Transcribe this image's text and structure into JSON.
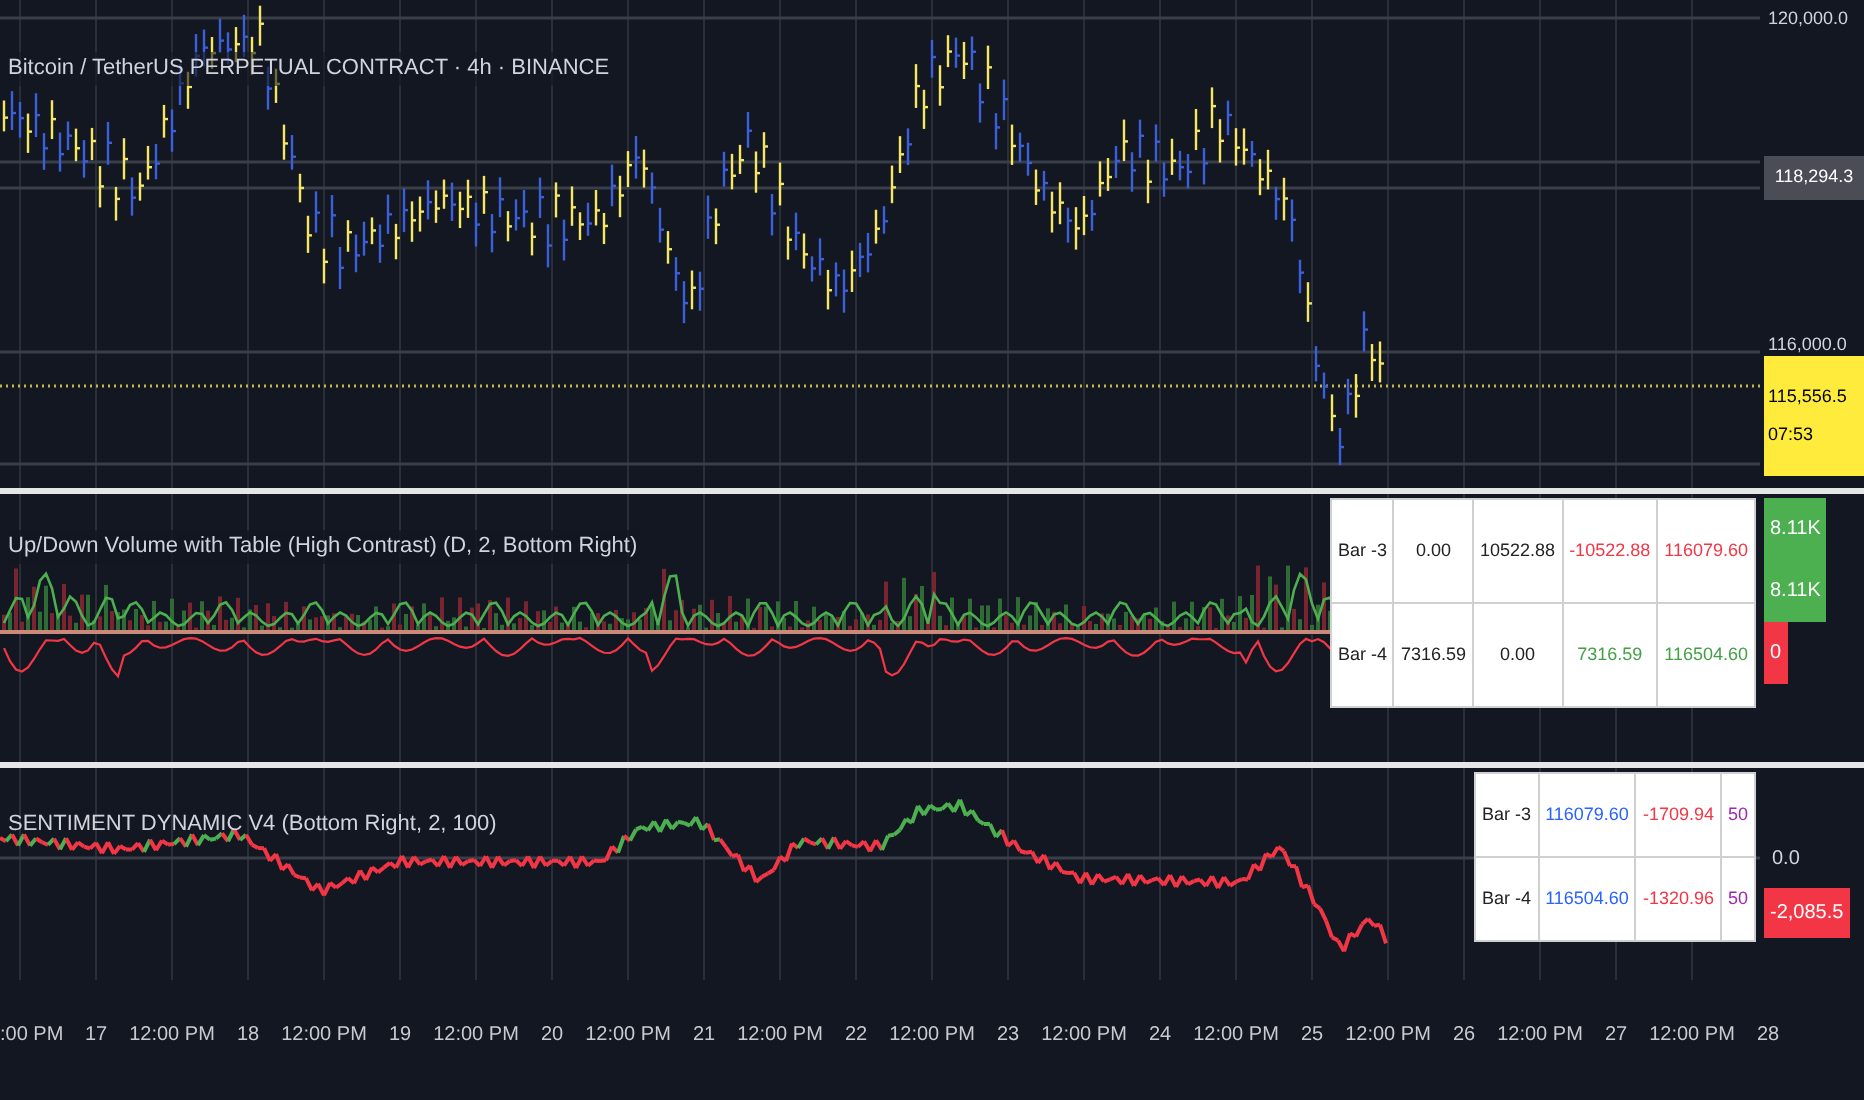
{
  "symbol_legend": "Bitcoin / TetherUS PERPETUAL CONTRACT · 4h · BINANCE",
  "price_axis": {
    "marks": [
      {
        "text": "120,000.0",
        "kind": "label"
      },
      {
        "text": "118,294.3",
        "kind": "tag"
      },
      {
        "text": "116,000.0",
        "kind": "label"
      }
    ],
    "last_price": {
      "price": "115,556.5",
      "countdown": "07:53"
    }
  },
  "volume_pane": {
    "legend": "Up/Down Volume with Table (High Contrast) (D, 2, Bottom Right)",
    "table": {
      "rows": [
        {
          "cells": [
            {
              "text": "Bar -3"
            },
            {
              "text": "0.00"
            },
            {
              "text": "10522.88"
            },
            {
              "text": "-10522.88",
              "color": "#f23645"
            },
            {
              "text": "116079.60",
              "color": "#f23645"
            }
          ]
        },
        {
          "cells": [
            {
              "text": "Bar -4"
            },
            {
              "text": "7316.59"
            },
            {
              "text": "0.00"
            },
            {
              "text": "7316.59",
              "color": "#43a047"
            },
            {
              "text": "116504.60",
              "color": "#43a047"
            }
          ]
        }
      ]
    },
    "axis_tags": [
      {
        "text": "8.11K",
        "color": "#4caf50"
      },
      {
        "text": "8.11K",
        "color": "#4caf50"
      },
      {
        "text": "0",
        "color": "#f23645"
      }
    ]
  },
  "sentiment_pane": {
    "legend": "SENTIMENT DYNAMIC V4 (Bottom Right, 2, 100)",
    "table": {
      "rows": [
        {
          "cells": [
            {
              "text": "Bar -3"
            },
            {
              "text": "116079.60",
              "color": "#2962ff"
            },
            {
              "text": "-1709.94",
              "color": "#f23645"
            },
            {
              "text": "50",
              "color": "#9c27b0"
            }
          ]
        },
        {
          "cells": [
            {
              "text": "Bar -4"
            },
            {
              "text": "116504.60",
              "color": "#2962ff"
            },
            {
              "text": "-1320.96",
              "color": "#f23645"
            },
            {
              "text": "50",
              "color": "#9c27b0"
            }
          ]
        }
      ]
    },
    "axis_label": "0.0",
    "axis_tag": {
      "text": "-2,085.5",
      "color": "#f23645"
    }
  },
  "time_axis": [
    ":00 PM",
    "17",
    "12:00 PM",
    "18",
    "12:00 PM",
    "19",
    "12:00 PM",
    "20",
    "12:00 PM",
    "21",
    "12:00 PM",
    "22",
    "12:00 PM",
    "23",
    "12:00 PM",
    "24",
    "12:00 PM",
    "25",
    "12:00 PM",
    "26",
    "12:00 PM",
    "27",
    "12:00 PM",
    "28"
  ]
}
